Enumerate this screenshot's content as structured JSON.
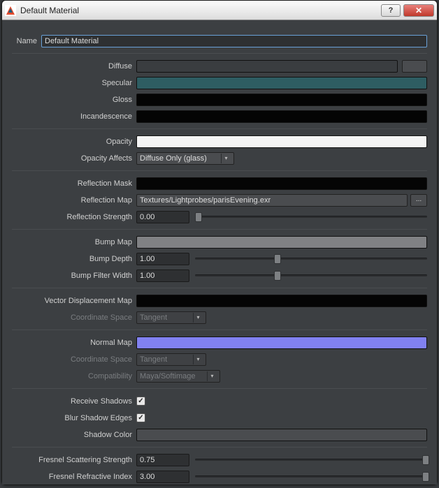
{
  "window": {
    "title": "Default Material"
  },
  "name_label": "Name",
  "name_value": "Default Material",
  "labels": {
    "diffuse": "Diffuse",
    "specular": "Specular",
    "gloss": "Gloss",
    "incandescence": "Incandescence",
    "opacity": "Opacity",
    "opacity_affects": "Opacity Affects",
    "reflection_mask": "Reflection Mask",
    "reflection_map": "Reflection Map",
    "reflection_strength": "Reflection Strength",
    "bump_map": "Bump Map",
    "bump_depth": "Bump Depth",
    "bump_filter_width": "Bump Filter Width",
    "vector_disp": "Vector Displacement Map",
    "coord_space": "Coordinate Space",
    "normal_map": "Normal Map",
    "compatibility": "Compatibility",
    "receive_shadows": "Receive Shadows",
    "blur_shadow_edges": "Blur Shadow Edges",
    "shadow_color": "Shadow Color",
    "fresnel_scatter": "Fresnel Scattering Strength",
    "fresnel_refract": "Fresnel Refractive Index"
  },
  "values": {
    "opacity_affects": "Diffuse Only (glass)",
    "reflection_map": "Textures/Lightprobes/parisEvening.exr",
    "reflection_strength": "0.00",
    "bump_depth": "1.00",
    "bump_filter_width": "1.00",
    "coord_space1": "Tangent",
    "coord_space2": "Tangent",
    "compatibility": "Maya/Softimage",
    "receive_shadows": true,
    "blur_shadow_edges": true,
    "fresnel_scatter": "0.75",
    "fresnel_refract": "3.00"
  },
  "colors": {
    "diffuse": "#3a3d40",
    "specular": "#2e5d62",
    "gloss": "#040404",
    "incandescence": "#040404",
    "opacity": "#f3f3f3",
    "reflection_mask": "#050505",
    "bump_map": "#808184",
    "vector_disp": "#040404",
    "normal_map": "#8181f0",
    "shadow_color": "#4a4c4f"
  },
  "browse_label": "...",
  "help_label": "?",
  "close_label": "✕"
}
